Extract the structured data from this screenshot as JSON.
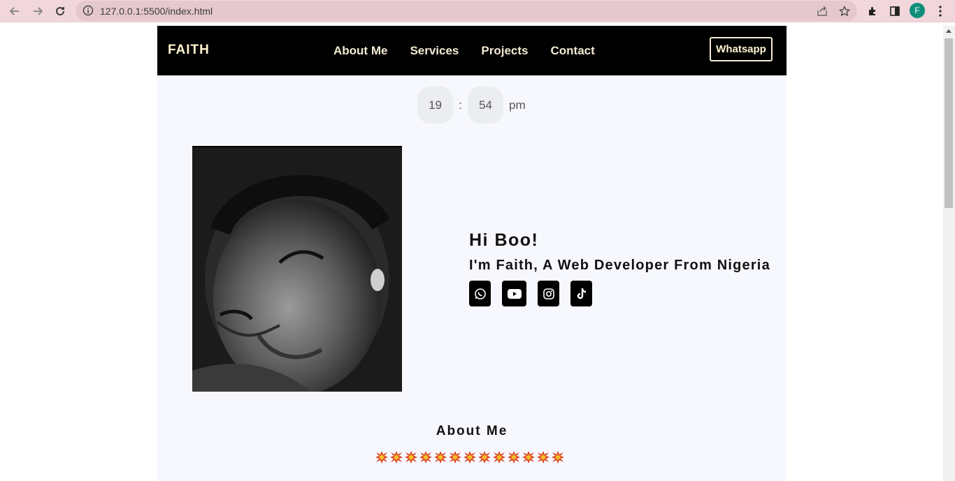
{
  "browser": {
    "url": "127.0.0.1:5500/index.html",
    "profile_initial": "F",
    "icons": [
      "back-icon",
      "forward-icon",
      "reload-icon",
      "info-icon",
      "share-icon",
      "star-icon",
      "extensions-icon",
      "sidepanel-icon",
      "menu-icon"
    ]
  },
  "nav": {
    "brand": "FAITH",
    "links": [
      "About Me",
      "Services",
      "Projects",
      "Contact"
    ],
    "whatsapp": "Whatsapp"
  },
  "clock": {
    "hours": "19",
    "separator": ":",
    "minutes": "54",
    "ampm": "pm"
  },
  "hero": {
    "greeting": "Hi Boo!",
    "intro": "I'm Faith, A Web Developer From Nigeria",
    "socials": [
      "whatsapp-icon",
      "youtube-icon",
      "instagram-icon",
      "tiktok-icon"
    ]
  },
  "about": {
    "title": "About Me",
    "divider_count": 13
  },
  "colors": {
    "chrome": "#f1d6dc",
    "navbar": "#000000",
    "nav_text": "#f3ead2",
    "page_bg": "#f7f8fd",
    "avatar": "#0f8f7a"
  }
}
